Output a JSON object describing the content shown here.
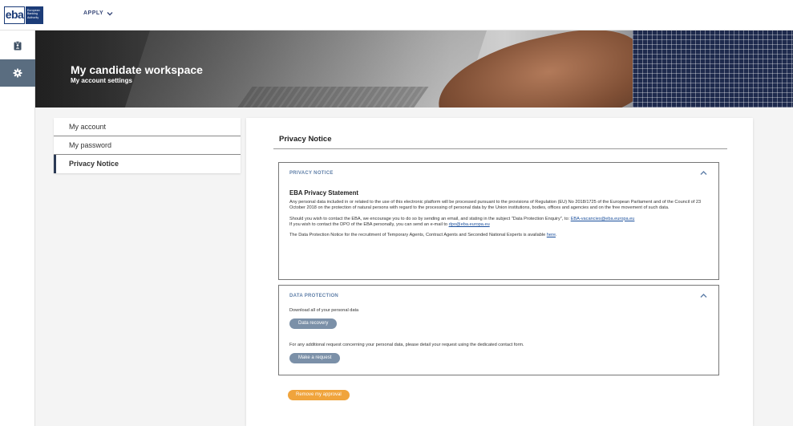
{
  "header": {
    "logo_text": "eba",
    "logo_lines": [
      "European",
      "Banking",
      "Authority"
    ],
    "apply_label": "APPLY"
  },
  "rail": {
    "items": [
      {
        "icon": "clipboard-icon",
        "active": false
      },
      {
        "icon": "gear-icon",
        "active": true
      }
    ]
  },
  "hero": {
    "title": "My candidate workspace",
    "subtitle": "My account settings"
  },
  "side_menu": {
    "items": [
      {
        "label": "My account"
      },
      {
        "label": "My password"
      },
      {
        "label": "Privacy Notice"
      }
    ],
    "active_index": 2
  },
  "panel": {
    "title": "Privacy Notice",
    "privacy_section": {
      "heading": "PRIVACY NOTICE",
      "statement_title": "EBA Privacy Statement",
      "paragraph1": "Any personal data included in or related to the use of this electronic platform will be processed pursuant to the provisions of Regulation (EU) No 2018/1725 of the European Parliament and of the Council of 23 October 2018 on the protection of natural persons with regard to the processing of personal data by the Union institutions, bodies, offices and agencies and on the free movement of such data.",
      "contact_text": "Should you wish to contact the EBA, we encourage you to do so by sending an email, and stating in the subject \"Data Protection Enquiry\", to: ",
      "contact_email": "EBA-vacancies@eba.europa.eu",
      "dpo_text": "If you wish to contact the DPO of the EBA personally, you can send an e-mail to ",
      "dpo_email": "dpo@eba.europa.eu",
      "notice_text": "The Data Protection Notice for the recruitment of Temporary Agents, Contract Agents and Seconded National Experts is available ",
      "notice_link": "here",
      "notice_end": "."
    },
    "data_section": {
      "heading": "DATA PROTECTION",
      "download_text": "Download all of your personal data",
      "recovery_button": "Data recovery",
      "request_text": "For any additional request concerning your personal data, please detail your request using the dedicated contact form.",
      "request_button": "Make a request"
    },
    "remove_button": "Remove my approval"
  },
  "colors": {
    "accent": "#f0a43c",
    "secondary_button": "#7b90a8",
    "rail_active": "#5a6d80",
    "section_heading": "#5f7fa8"
  }
}
